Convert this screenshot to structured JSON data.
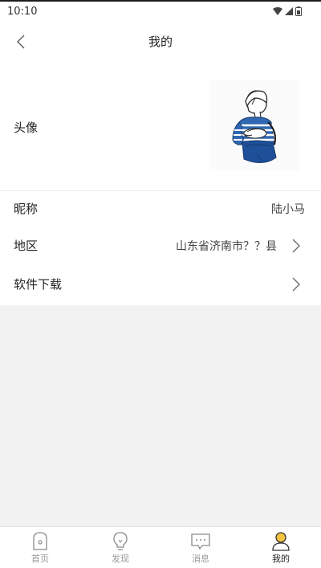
{
  "status_bar": {
    "time": "10:10"
  },
  "header": {
    "title": "我的"
  },
  "profile": {
    "avatar_label": "头像",
    "nickname_label": "昵称",
    "nickname_value": "陆小马",
    "region_label": "地区",
    "region_value": "山东省济南市？？县",
    "download_label": "软件下载"
  },
  "bottom_nav": {
    "items": [
      {
        "label": "首页",
        "icon": "home-icon"
      },
      {
        "label": "发现",
        "icon": "bulb-icon"
      },
      {
        "label": "消息",
        "icon": "message-icon"
      },
      {
        "label": "我的",
        "icon": "profile-icon"
      }
    ],
    "active_index": 3
  },
  "colors": {
    "accent": "#f5c342",
    "background": "#f2f2f2",
    "surface": "#ffffff",
    "inactive_nav": "#999999"
  }
}
